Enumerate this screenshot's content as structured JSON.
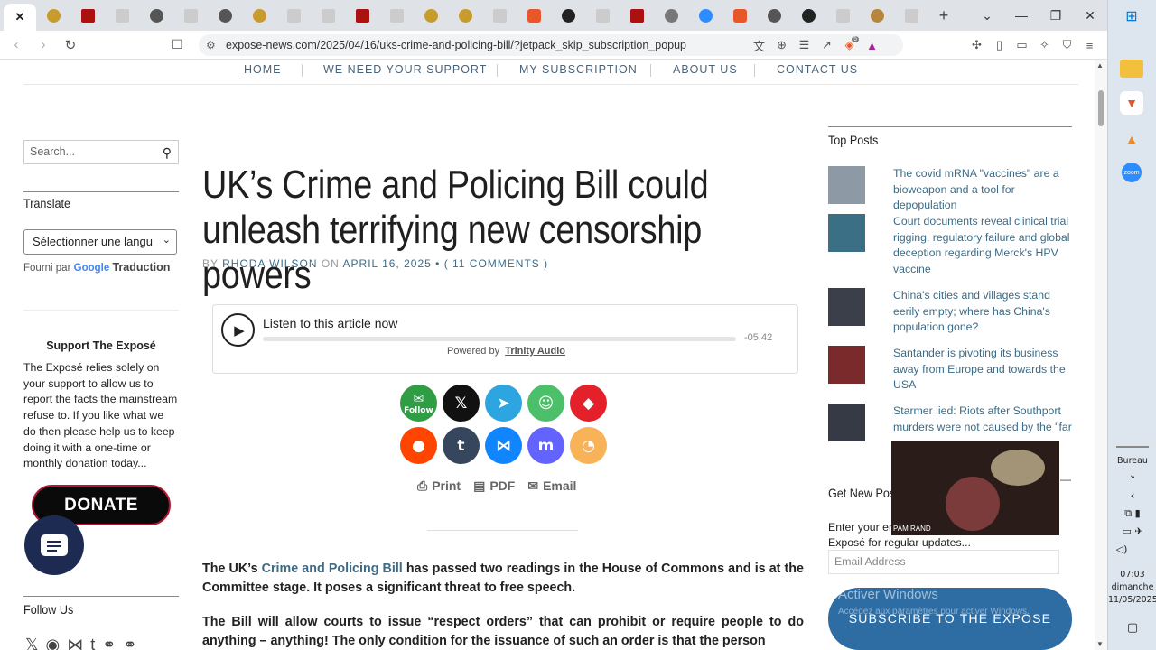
{
  "browser": {
    "tabs": [
      "x",
      "o",
      "r",
      "g",
      "o",
      "g",
      "o",
      "g",
      "o",
      "g",
      "r",
      "g",
      "o",
      "o",
      "g",
      "b",
      "k",
      "g",
      "r",
      "g",
      "s",
      "b",
      "o",
      "k",
      "g",
      "k",
      "o",
      "g"
    ],
    "new_tab": "+",
    "url": "expose-news.com/2025/04/16/uks-crime-and-policing-bill/?jetpack_skip_subscription_popup",
    "shield_badge": "5"
  },
  "nav": {
    "items": [
      "HOME",
      "WE NEED YOUR SUPPORT",
      "MY SUBSCRIPTION",
      "ABOUT US",
      "CONTACT US"
    ]
  },
  "left": {
    "search_placeholder": "Search...",
    "translate_title": "Translate",
    "select_value": "Sélectionner une langu",
    "powered_by": "Fourni par",
    "google": "Google",
    "translation": "Traduction",
    "support_title": "Support The Exposé",
    "support_text": "The Exposé relies solely on your support to allow us to report the facts the mainstream refuse to. If you like what we do then please help us to keep doing it with a one-time or monthly donation today...",
    "donate": "DONATE",
    "follow_title": "Follow Us"
  },
  "article": {
    "title": "UK’s Crime and Policing Bill could unleash terrifying new censorship powers",
    "by": "BY",
    "author": "RHODA WILSON",
    "on": "ON",
    "date": "APRIL 16, 2025",
    "comments": "( 11 COMMENTS )",
    "audio_label": "Listen to this article now",
    "audio_time": "-05:42",
    "powered": "Powered by",
    "trinity": "Trinity Audio",
    "print": "Print",
    "pdf": "PDF",
    "email": "Email",
    "p1_a": "The UK’s ",
    "p1_link": "Crime and Policing Bill",
    "p1_b": " has passed two readings in the House of Commons and is at the Committee stage.  It poses a significant threat to free speech.",
    "p2": "The Bill will allow courts to issue “respect orders” that can prohibit or require people to do anything – anything! The only condition for the issuance of such an order is that the person"
  },
  "right": {
    "top_posts": "Top Posts",
    "posts": [
      "The covid mRNA \"vaccines\" are a bioweapon and a tool for depopulation",
      "Court documents reveal clinical trial rigging, regulatory failure and global deception regarding Merck's HPV vaccine",
      "China's cities and villages stand eerily empty; where has China's population gone?",
      "Santander is pivoting its business away from Europe and towards the USA",
      "Starmer lied: Riots after Southport murders were not caused by the \"far"
    ],
    "get_new": "Get New Post",
    "enter_text": "Enter your em",
    "enter_text2": "Exposé for regular updates...",
    "email_placeholder": "Email Address",
    "subscribe": "SUBSCRIBE TO THE EXPOSE",
    "video_name": "PAM RAND",
    "watermark": "Activer Windows",
    "watermark2": "Accédez aux paramètres pour activer Windows."
  },
  "taskbar": {
    "bureau": "Bureau",
    "time": "07:03",
    "day": "dimanche",
    "date": "11/05/2025"
  },
  "colors": {
    "accent": "#3d6b86",
    "subscribe": "#2e6da4",
    "donate_border": "#b41539"
  }
}
